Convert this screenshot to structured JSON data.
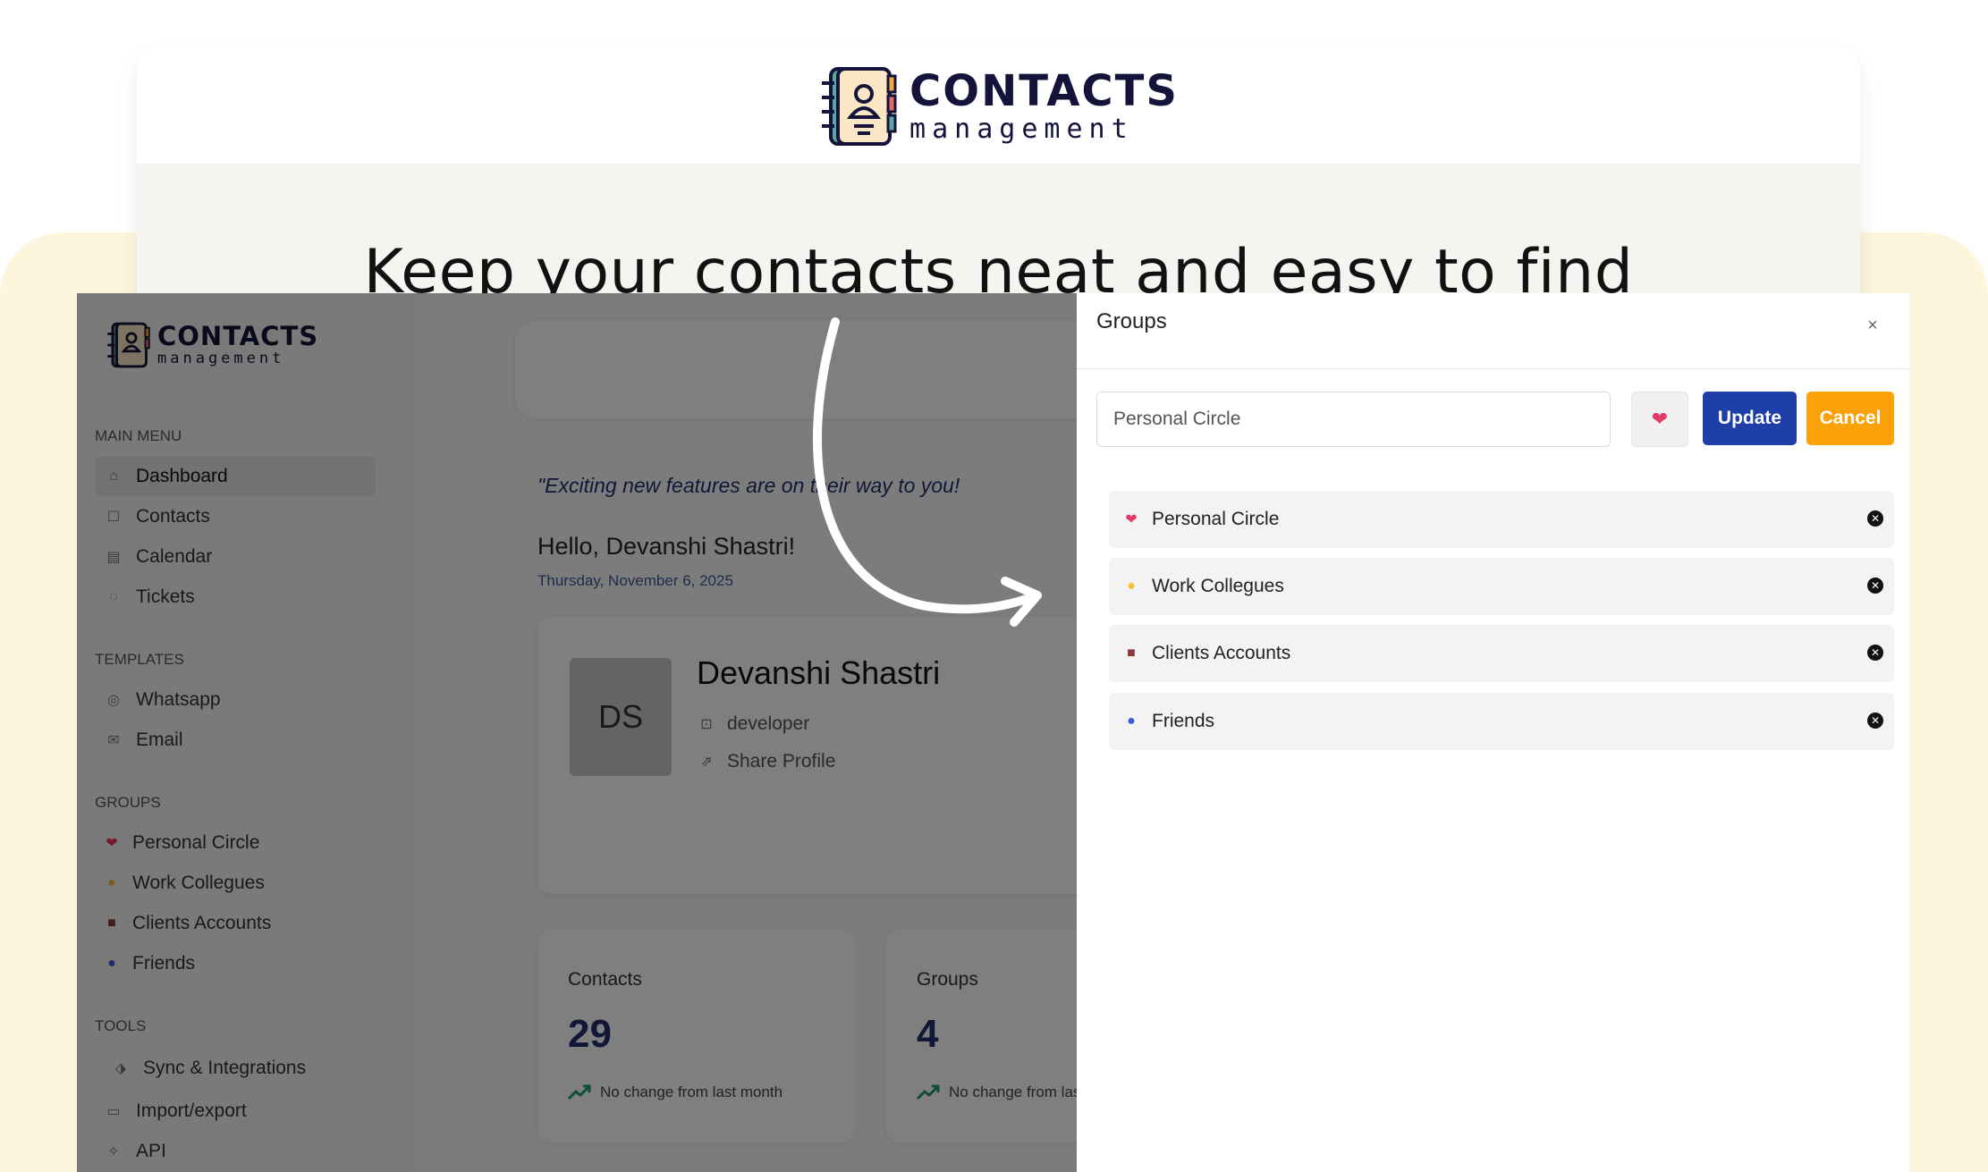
{
  "brand": {
    "title": "CONTACTS",
    "subtitle": "management"
  },
  "tagline": "Keep your contacts neat and easy to find",
  "sidebar": {
    "sections": {
      "main_menu": "MAIN MENU",
      "templates": "TEMPLATES",
      "groups": "GROUPS",
      "tools": "TOOLS"
    },
    "main_items": [
      {
        "label": "Dashboard",
        "icon": "home-icon"
      },
      {
        "label": "Contacts",
        "icon": "contacts-icon"
      },
      {
        "label": "Calendar",
        "icon": "calendar-icon"
      },
      {
        "label": "Tickets",
        "icon": "ticket-icon"
      }
    ],
    "template_items": [
      {
        "label": "Whatsapp",
        "icon": "whatsapp-icon"
      },
      {
        "label": "Email",
        "icon": "mail-icon"
      }
    ],
    "group_items": [
      {
        "label": "Personal Circle",
        "icon": "heart-icon",
        "glyph": "❤",
        "color": "#e23b4e"
      },
      {
        "label": "Work Collegues",
        "icon": "handshake-icon",
        "glyph": "●",
        "color": "#f2c233"
      },
      {
        "label": "Clients Accounts",
        "icon": "briefcase-icon",
        "glyph": "■",
        "color": "#8a3b3b"
      },
      {
        "label": "Friends",
        "icon": "globe-icon",
        "glyph": "●",
        "color": "#3b5bd6"
      }
    ],
    "tool_items": [
      {
        "label": "Sync & Integrations",
        "icon": "tag-icon"
      },
      {
        "label": "Import/export",
        "icon": "folder-icon"
      },
      {
        "label": "API",
        "icon": "api-icon"
      }
    ]
  },
  "main": {
    "quote": "\"Exciting new features are on their way to you!",
    "greeting": "Hello, Devanshi Shastri!",
    "date": "Thursday, November 6, 2025",
    "profile": {
      "initials": "DS",
      "name": "Devanshi Shastri",
      "role": "developer",
      "share": "Share Profile"
    },
    "stats": [
      {
        "label": "Contacts",
        "value": "29",
        "note": "No change from last month"
      },
      {
        "label": "Groups",
        "value": "4",
        "note": "No change from last month"
      }
    ]
  },
  "panel": {
    "title": "Groups",
    "input_value": "Personal Circle",
    "emoji": "❤",
    "update_label": "Update",
    "cancel_label": "Cancel",
    "groups": [
      {
        "label": "Personal Circle",
        "icon": "heart-icon",
        "glyph": "❤",
        "color": "#e23b6a"
      },
      {
        "label": "Work Collegues",
        "icon": "handshake-icon",
        "glyph": "●",
        "color": "#f2c233"
      },
      {
        "label": "Clients Accounts",
        "icon": "briefcase-icon",
        "glyph": "■",
        "color": "#8a3b3b"
      },
      {
        "label": "Friends",
        "icon": "globe-icon",
        "glyph": "●",
        "color": "#3b5bd6"
      }
    ]
  },
  "colors": {
    "accent_blue": "#1f3fa8",
    "accent_orange": "#fba10a",
    "navy": "#23306e",
    "cream_bg": "#fdf5dc"
  }
}
